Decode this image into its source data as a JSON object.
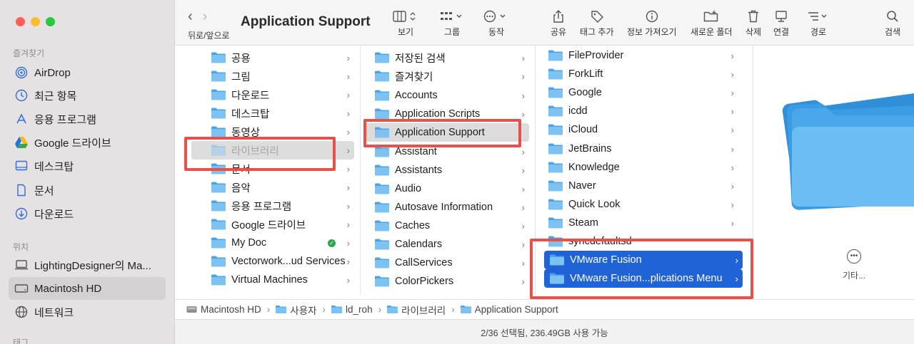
{
  "sidebar": {
    "favorites_title": "즐겨찾기",
    "locations_title": "위치",
    "tags_title": "태그",
    "favorites": [
      {
        "label": "AirDrop",
        "icon": "airdrop-icon"
      },
      {
        "label": "최근 항목",
        "icon": "clock-icon"
      },
      {
        "label": "응용 프로그램",
        "icon": "applications-icon"
      },
      {
        "label": "Google 드라이브",
        "icon": "google-drive-icon"
      },
      {
        "label": "데스크탑",
        "icon": "desktop-icon"
      },
      {
        "label": "문서",
        "icon": "document-icon"
      },
      {
        "label": "다운로드",
        "icon": "download-icon"
      }
    ],
    "locations": [
      {
        "label": "LightingDesigner의 Ma...",
        "icon": "laptop-icon"
      },
      {
        "label": "Macintosh HD",
        "icon": "disk-icon",
        "active": true
      },
      {
        "label": "네트워크",
        "icon": "network-icon"
      }
    ]
  },
  "toolbar": {
    "title": "Application Support",
    "nav_label": "뒤로/앞으로",
    "view_label": "보기",
    "group_label": "그룹",
    "action_label": "동작",
    "share_label": "공유",
    "tag_label": "태그 추가",
    "info_label": "정보 가져오기",
    "new_folder_label": "새로운 폴더",
    "delete_label": "삭제",
    "connect_label": "연결",
    "path_label": "경로",
    "search_label": "검색"
  },
  "columns": [
    {
      "items": [
        {
          "label": "공용"
        },
        {
          "label": "그림"
        },
        {
          "label": "다운로드"
        },
        {
          "label": "데스크탑"
        },
        {
          "label": "동영상"
        },
        {
          "label": "라이브러리",
          "state": "selected-dim"
        },
        {
          "label": "문서"
        },
        {
          "label": "음악"
        },
        {
          "label": "응용 프로그램"
        },
        {
          "label": "Google 드라이브"
        },
        {
          "label": "My Doc",
          "badge": "synced"
        },
        {
          "label": "Vectorwork...ud Services"
        },
        {
          "label": "Virtual Machines"
        }
      ]
    },
    {
      "items": [
        {
          "label": "저장된 검색"
        },
        {
          "label": "즐겨찾기"
        },
        {
          "label": "Accounts"
        },
        {
          "label": "Application Scripts"
        },
        {
          "label": "Application Support",
          "state": "selected"
        },
        {
          "label": "Assistant"
        },
        {
          "label": "Assistants"
        },
        {
          "label": "Audio"
        },
        {
          "label": "Autosave Information"
        },
        {
          "label": "Caches"
        },
        {
          "label": "Calendars"
        },
        {
          "label": "CallServices"
        },
        {
          "label": "ColorPickers"
        }
      ]
    },
    {
      "items": [
        {
          "label": "FileProvider"
        },
        {
          "label": "ForkLift"
        },
        {
          "label": "Google"
        },
        {
          "label": "icdd"
        },
        {
          "label": "iCloud"
        },
        {
          "label": "JetBrains"
        },
        {
          "label": "Knowledge"
        },
        {
          "label": "Naver"
        },
        {
          "label": "Quick Look"
        },
        {
          "label": "Steam"
        },
        {
          "label": "syncdefaultsd"
        },
        {
          "label": "VMware Fusion",
          "state": "selected-blue"
        },
        {
          "label": "VMware Fusion...plications Menu",
          "state": "selected-blue"
        }
      ]
    }
  ],
  "preview": {
    "more_label": "기타..."
  },
  "pathbar": [
    {
      "label": "Macintosh HD",
      "icon": "disk-icon"
    },
    {
      "label": "사용자",
      "icon": "folder-icon"
    },
    {
      "label": "ld_roh",
      "icon": "home-folder-icon"
    },
    {
      "label": "라이브러리",
      "icon": "folder-icon"
    },
    {
      "label": "Application Support",
      "icon": "folder-icon"
    }
  ],
  "status": "2/36 선택됨, 236.49GB 사용 가능",
  "colors": {
    "accent": "#1f63d6",
    "folder": "#4ba3e8",
    "highlight": "#e8514a"
  }
}
